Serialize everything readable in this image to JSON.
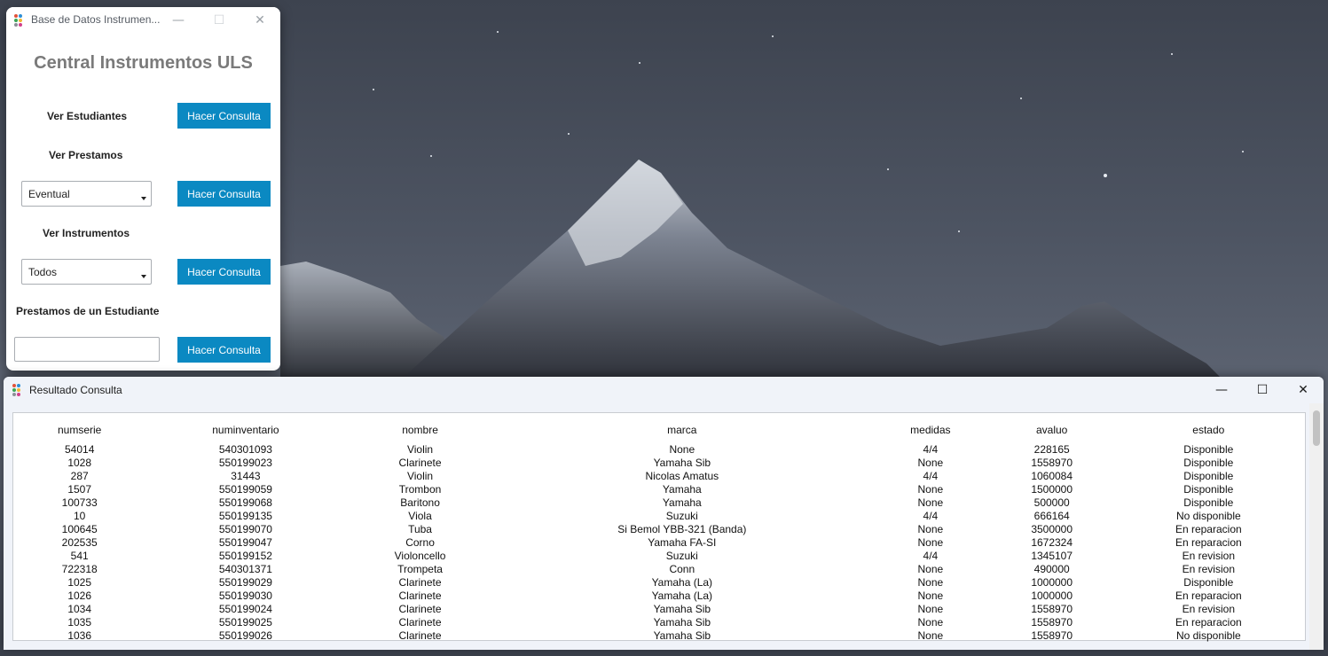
{
  "main_window": {
    "title": "Base de Datos Instrumen...",
    "controls": {
      "minimize": "—",
      "maximize": "☐",
      "close": "✕"
    },
    "heading": "Central Instrumentos ULS",
    "students_label": "Ver Estudiantes",
    "loans_label": "Ver Prestamos",
    "loans_select_value": "Eventual",
    "instruments_label": "Ver Instrumentos",
    "instruments_select_value": "Todos",
    "student_loans_label": "Prestamos de un Estudiante",
    "student_input_value": "",
    "query_button_label": "Hacer Consulta"
  },
  "result_window": {
    "title": "Resultado Consulta",
    "controls": {
      "minimize": "—",
      "maximize": "☐",
      "close": "✕"
    },
    "columns": [
      "numserie",
      "numinventario",
      "nombre",
      "marca",
      "medidas",
      "avaluo",
      "estado"
    ],
    "rows": [
      [
        "54014",
        "540301093",
        "Violin",
        "None",
        "4/4",
        "228165",
        "Disponible"
      ],
      [
        "1028",
        "550199023",
        "Clarinete",
        "Yamaha Sib",
        "None",
        "1558970",
        "Disponible"
      ],
      [
        "287",
        "31443",
        "Violin",
        "Nicolas Amatus",
        "4/4",
        "1060084",
        "Disponible"
      ],
      [
        "1507",
        "550199059",
        "Trombon",
        "Yamaha",
        "None",
        "1500000",
        "Disponible"
      ],
      [
        "100733",
        "550199068",
        "Baritono",
        "Yamaha",
        "None",
        "500000",
        "Disponible"
      ],
      [
        "10",
        "550199135",
        "Viola",
        "Suzuki",
        "4/4",
        "666164",
        "No disponible"
      ],
      [
        "100645",
        "550199070",
        "Tuba",
        "Si Bemol YBB-321  (Banda)",
        "None",
        "3500000",
        "En reparacion"
      ],
      [
        "202535",
        "550199047",
        "Corno",
        "Yamaha FA-SI",
        "None",
        "1672324",
        "En reparacion"
      ],
      [
        "541",
        "550199152",
        "Violoncello",
        "Suzuki",
        "4/4",
        "1345107",
        "En revision"
      ],
      [
        "722318",
        "540301371",
        "Trompeta",
        "Conn",
        "None",
        "490000",
        "En revision"
      ],
      [
        "1025",
        "550199029",
        "Clarinete",
        "Yamaha (La)",
        "None",
        "1000000",
        "Disponible"
      ],
      [
        "1026",
        "550199030",
        "Clarinete",
        "Yamaha (La)",
        "None",
        "1000000",
        "En reparacion"
      ],
      [
        "1034",
        "550199024",
        "Clarinete",
        "Yamaha Sib",
        "None",
        "1558970",
        "En revision"
      ],
      [
        "1035",
        "550199025",
        "Clarinete",
        "Yamaha Sib",
        "None",
        "1558970",
        "En reparacion"
      ],
      [
        "1036",
        "550199026",
        "Clarinete",
        "Yamaha Sib",
        "None",
        "1558970",
        "No disponible"
      ]
    ]
  },
  "colors": {
    "button_bg": "#0b89c2",
    "heading_text": "#7a7a7a",
    "icon_dots": [
      "#e2533a",
      "#2d8fd6",
      "#3aa655",
      "#f2b632",
      "#8a8f96",
      "#d23f8a"
    ]
  }
}
